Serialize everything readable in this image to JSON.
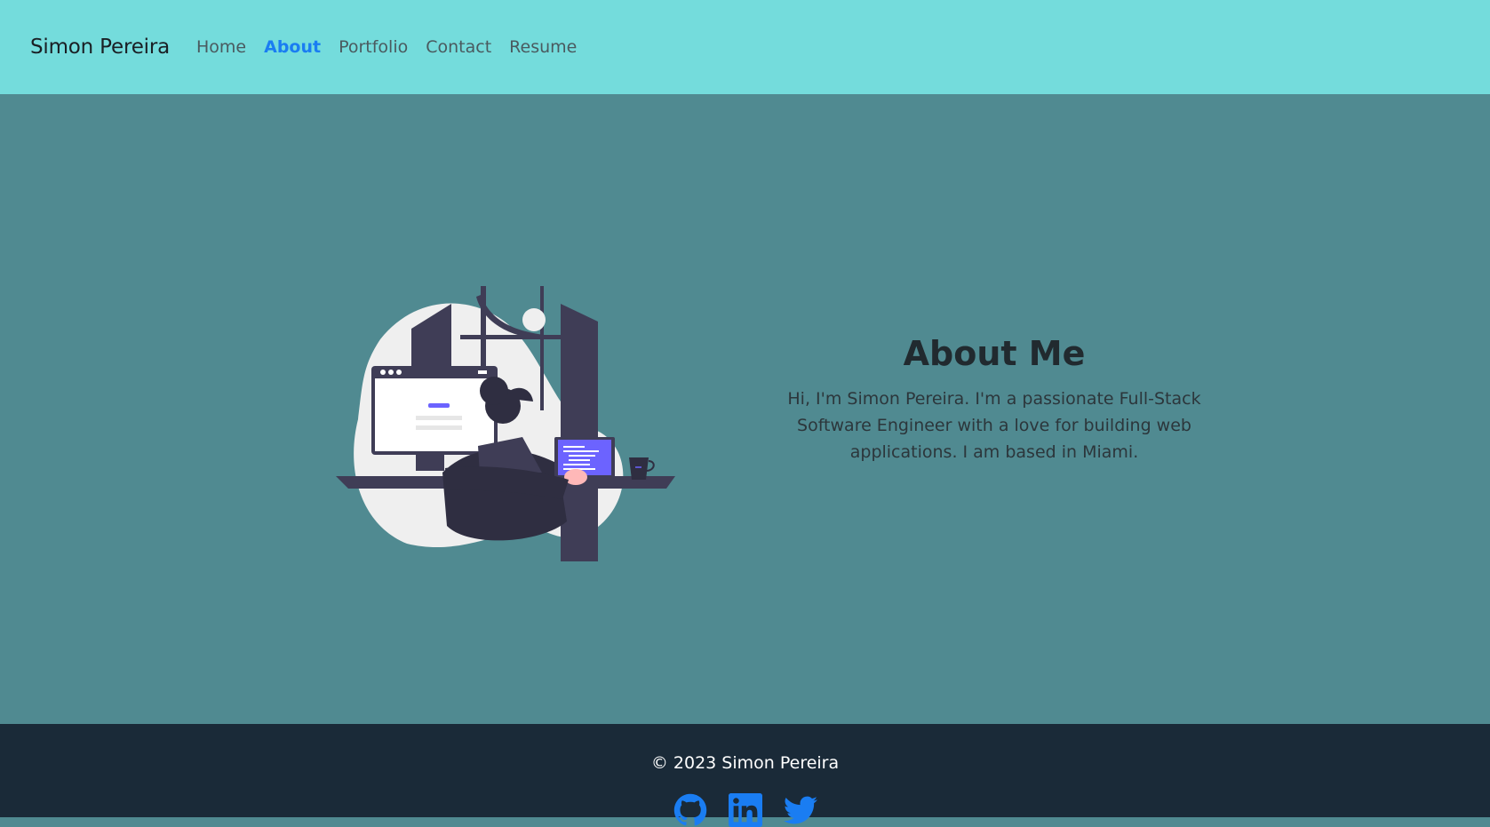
{
  "navbar": {
    "brand": "Simon Pereira",
    "items": [
      {
        "label": "Home",
        "active": false
      },
      {
        "label": "About",
        "active": true
      },
      {
        "label": "Portfolio",
        "active": false
      },
      {
        "label": "Contact",
        "active": false
      },
      {
        "label": "Resume",
        "active": false
      }
    ]
  },
  "about": {
    "title": "About Me",
    "text": "Hi, I'm Simon Pereira. I'm a passionate Full-Stack Software Engineer with a love for building web applications. I am based in Miami."
  },
  "illustration": {
    "icon": "developer-at-desk-illustration"
  },
  "footer": {
    "copyright": "© 2023 Simon Pereira",
    "socials": [
      {
        "name": "github-icon"
      },
      {
        "name": "linkedin-icon"
      },
      {
        "name": "twitter-icon"
      }
    ]
  },
  "colors": {
    "navbar_bg": "#74dcdc",
    "main_bg": "#508a91",
    "footer_bg": "#1a2a38",
    "accent": "#1a7df2"
  }
}
